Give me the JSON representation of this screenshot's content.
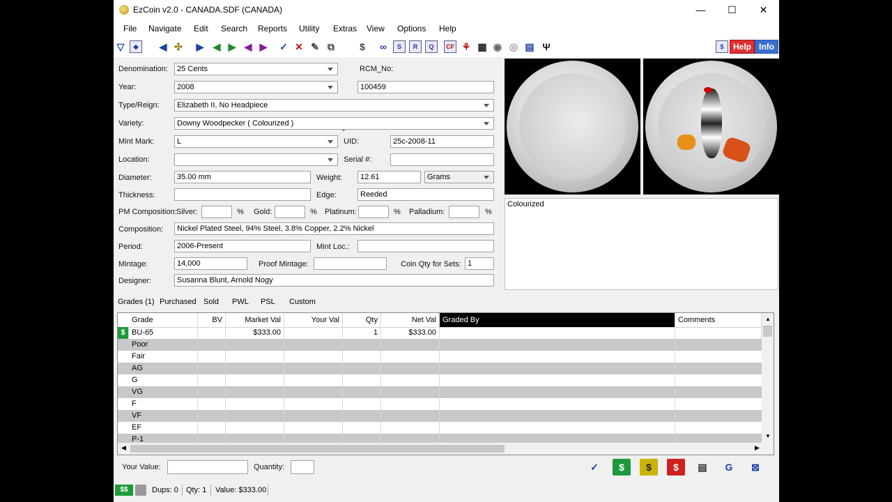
{
  "window": {
    "title": "EzCoin v2.0 - CANADA.SDF (CANADA)",
    "minimize": "—",
    "maximize": "☐",
    "close": "✕"
  },
  "menu": [
    "File",
    "Navigate",
    "Edit",
    "Search",
    "Reports",
    "Utility",
    "Extras",
    "View",
    "Options",
    "Help"
  ],
  "toolbar_right": {
    "help": "Help",
    "info": "Info"
  },
  "form": {
    "denomination_label": "Denomination:",
    "denomination": "25 Cents",
    "rcm_label": "RCM_No:",
    "rcm": "100459",
    "year_label": "Year:",
    "year": "2008",
    "type_label": "Type/Reign:",
    "type": "Elizabeth II, No Headpiece",
    "variety_label": "Variety:",
    "variety": "Downy Woodpecker ( Colourized )",
    "mint_label": "Mint Mark:",
    "mint": "L",
    "uid_label": "UID:",
    "uid": "25c-2008-11",
    "location_label": "Location:",
    "location": "",
    "serial_label": "Serial #:",
    "serial": "",
    "diameter_label": "Diameter:",
    "diameter": "35.00 mm",
    "weight_label": "Weight:",
    "weight": "12.61",
    "weight_unit": "Grams",
    "thickness_label": "Thickness:",
    "thickness": "",
    "edge_label": "Edge:",
    "edge": "Reeded",
    "pm_label": "PM Composition:",
    "silver_label": "Silver:",
    "gold_label": "Gold:",
    "platinum_label": "Platinum:",
    "palladium_label": "Palladium:",
    "pct": "%",
    "composition_label": "Composition:",
    "composition": "Nickel Plated Steel, 94% Steel, 3.8% Copper, 2.2% Nickel",
    "period_label": "Period:",
    "period": "2006-Present",
    "mintloc_label": "Mint Loc.:",
    "mintloc": "",
    "mintage_label": "Mintage:",
    "mintage": "14,000",
    "proof_label": "Proof Mintage:",
    "proof": "",
    "qtysets_label": "Coin Qty for Sets:",
    "qtysets": "1",
    "designer_label": "Designer:",
    "designer": "Susanna Blunt, Arnold Nogy"
  },
  "comments_box": "Colourized",
  "tabs": [
    "Grades (1)",
    "Purchased",
    "Sold",
    "PWL",
    "PSL",
    "Custom"
  ],
  "grid": {
    "headers": [
      "Grade",
      "BV",
      "Market Val",
      "Your Val",
      "Qty",
      "Net Val",
      "Graded By",
      "Comments"
    ],
    "rows": [
      {
        "grade": "BU-65",
        "bv": "",
        "market": "$333.00",
        "your": "",
        "qty": "1",
        "net": "$333.00"
      },
      {
        "grade": "Poor"
      },
      {
        "grade": "Fair"
      },
      {
        "grade": "AG"
      },
      {
        "grade": "G"
      },
      {
        "grade": "VG"
      },
      {
        "grade": "F"
      },
      {
        "grade": "VF"
      },
      {
        "grade": "EF"
      },
      {
        "grade": "P-1"
      }
    ]
  },
  "bottom": {
    "your_value_label": "Your Value:",
    "your_value": "",
    "quantity_label": "Quantity:",
    "quantity": ""
  },
  "status": {
    "dups": "Dups: 0",
    "qty": "Qty: 1",
    "value": "Value: $333.00"
  },
  "colors": {
    "accent": "#3a6fd0",
    "alt_row": "#c8c8c8",
    "check": "#118a2a"
  }
}
